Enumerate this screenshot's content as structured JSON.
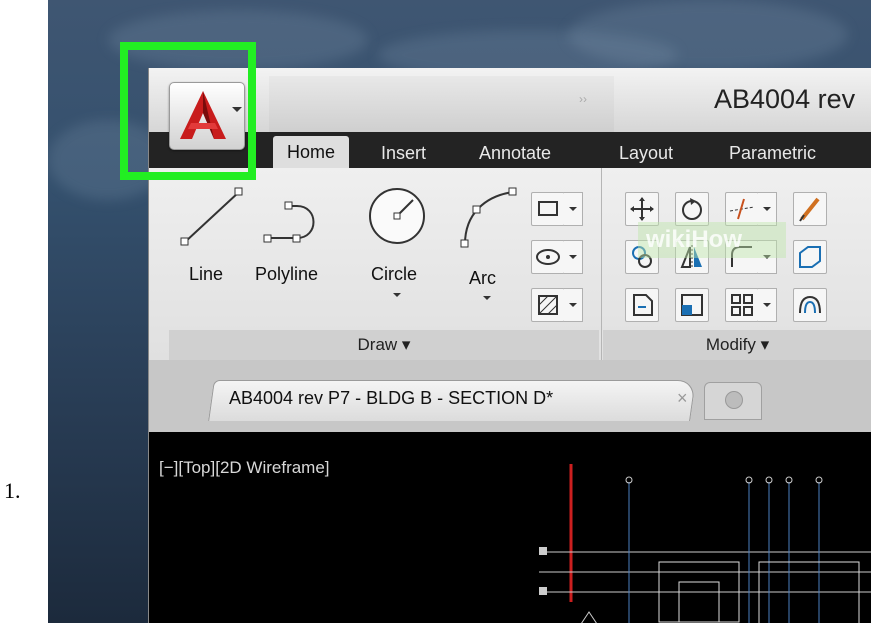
{
  "list_number": "1.",
  "window": {
    "title": "AB4004 rev"
  },
  "ribbon_tabs": [
    {
      "label": "Home",
      "active": true
    },
    {
      "label": "Insert",
      "active": false
    },
    {
      "label": "Annotate",
      "active": false
    },
    {
      "label": "Layout",
      "active": false
    },
    {
      "label": "Parametric",
      "active": false
    }
  ],
  "draw_panel": {
    "tools": [
      {
        "label": "Line"
      },
      {
        "label": "Polyline"
      },
      {
        "label": "Circle"
      },
      {
        "label": "Arc"
      }
    ],
    "title": "Draw"
  },
  "modify_panel": {
    "title": "Modify"
  },
  "document_tab": {
    "label": "AB4004 rev P7 - BLDG B - SECTION D*",
    "close": "×"
  },
  "viewport": {
    "label": "[−][Top][2D Wireframe]"
  },
  "highlight_color": "#22ee22",
  "accent_red": "#cc1f1f",
  "watermark": "wikiHow"
}
